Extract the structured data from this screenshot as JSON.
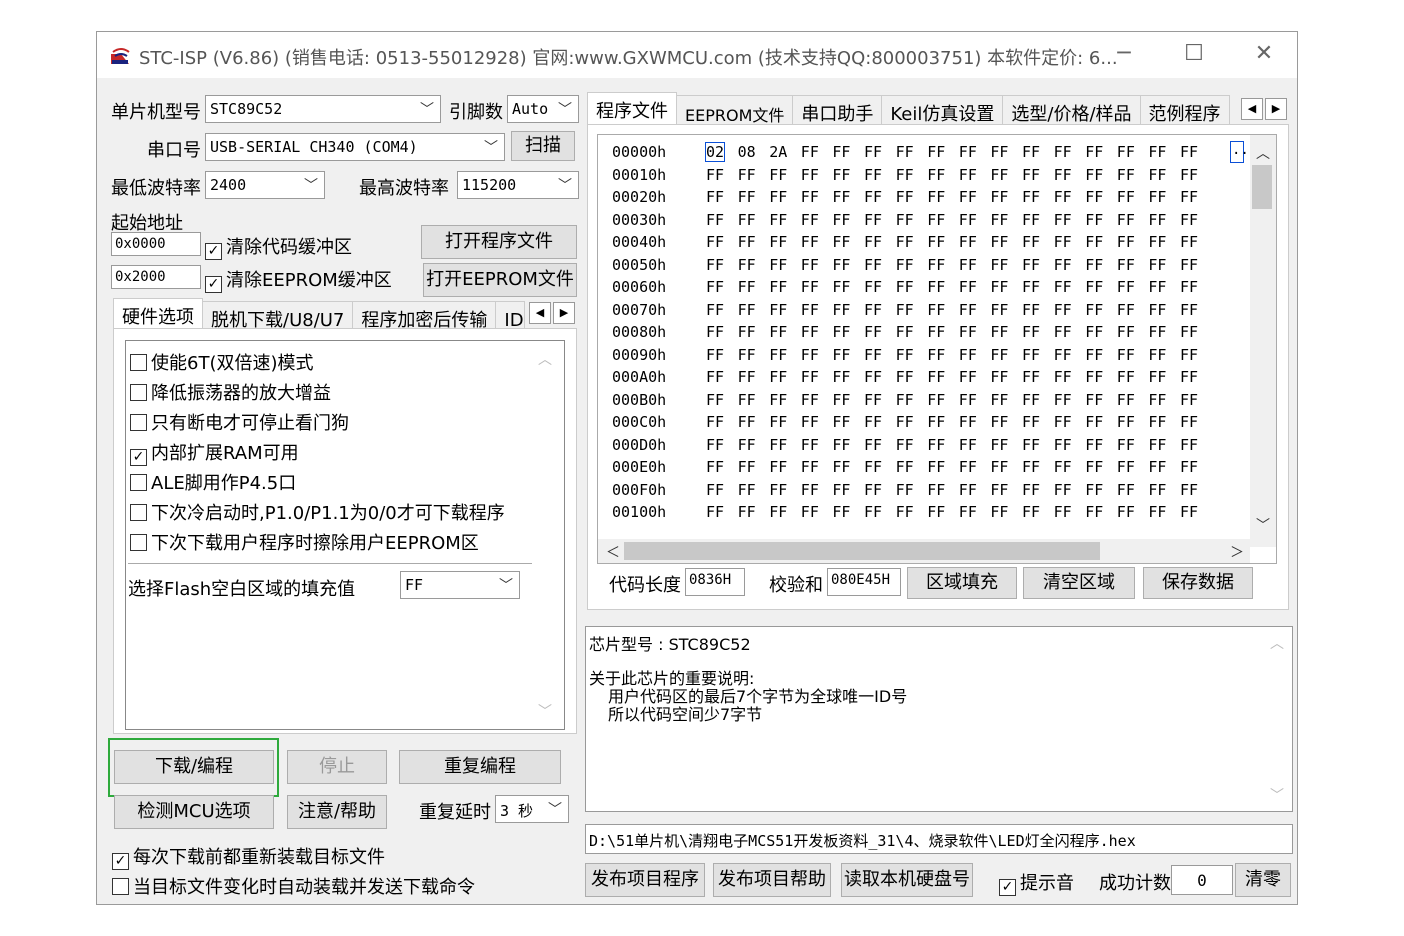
{
  "window": {
    "title": "STC-ISP (V6.86) (销售电话: 0513-55012928) 官网:www.GXWMCU.com  (技术支持QQ:800003751) 本软件定价: 6...",
    "minimize": "─",
    "maximize": "☐",
    "close": "✕"
  },
  "left": {
    "mcu_label": "单片机型号",
    "mcu_value": "STC89C52",
    "pins_label": "引脚数",
    "pins_value": "Auto",
    "port_label": "串口号",
    "port_value": "USB-SERIAL CH340 (COM4)",
    "scan_button": "扫描",
    "min_baud_label": "最低波特率",
    "min_baud_value": "2400",
    "max_baud_label": "最高波特率",
    "max_baud_value": "115200",
    "start_addr_label": "起始地址",
    "addr1": "0x0000",
    "clear_code_label": "清除代码缓冲区",
    "open_program_button": "打开程序文件",
    "addr2": "0x2000",
    "clear_eeprom_label": "清除EEPROM缓冲区",
    "open_eeprom_button": "打开EEPROM文件",
    "tabs": [
      "硬件选项",
      "脱机下载/U8/U7",
      "程序加密后传输",
      "ID号"
    ],
    "options": [
      {
        "label": "使能6T(双倍速)模式",
        "checked": false
      },
      {
        "label": "降低振荡器的放大增益",
        "checked": false
      },
      {
        "label": "只有断电才可停止看门狗",
        "checked": false
      },
      {
        "label": "内部扩展RAM可用",
        "checked": true
      },
      {
        "label": "ALE脚用作P4.5口",
        "checked": false
      },
      {
        "label": "下次冷启动时,P1.0/P1.1为0/0才可下载程序",
        "checked": false
      },
      {
        "label": "下次下载用户程序时擦除用户EEPROM区",
        "checked": false
      }
    ],
    "flash_fill_label": "选择Flash空白区域的填充值",
    "flash_fill_value": "FF",
    "download_button": "下载/编程",
    "stop_button": "停止",
    "reprogram_button": "重复编程",
    "check_mcu_button": "检测MCU选项",
    "help_button": "注意/帮助",
    "repeat_delay_label": "重复延时",
    "repeat_delay_value": "3 秒",
    "reload_label": "每次下载前都重新装载目标文件",
    "auto_load_label": "当目标文件变化时自动装载并发送下载命令"
  },
  "right": {
    "tabs": [
      "程序文件",
      "EEPROM文件",
      "串口助手",
      "Keil仿真设置",
      "选型/价格/样品",
      "范例程序"
    ],
    "hex": {
      "first_row": [
        "02",
        "08",
        "2A",
        "FF",
        "FF",
        "FF",
        "FF",
        "FF",
        "FF",
        "FF",
        "FF",
        "FF",
        "FF",
        "FF",
        "FF",
        "FF"
      ],
      "fill_byte": "FF",
      "addresses": [
        "00000h",
        "00010h",
        "00020h",
        "00030h",
        "00040h",
        "00050h",
        "00060h",
        "00070h",
        "00080h",
        "00090h",
        "000A0h",
        "000B0h",
        "000C0h",
        "000D0h",
        "000E0h",
        "000F0h",
        "00100h"
      ],
      "ascii_first": ".."
    },
    "code_len_label": "代码长度",
    "code_len_value": "0836H",
    "checksum_label": "校验和",
    "checksum_value": "080E45H",
    "fill_region_button": "区域填充",
    "clear_region_button": "清空区域",
    "save_data_button": "保存数据",
    "info": {
      "chip_line": "芯片型号 : STC89C52",
      "note_title": "关于此芯片的重要说明:",
      "note_1": "用户代码区的最后7个字节为全球唯一ID号",
      "note_2": "所以代码空间少7字节"
    },
    "file_path": "D:\\51单片机\\清翔电子MCS51开发板资料_31\\4、烧录软件\\LED灯全闪程序.hex",
    "publish_program_button": "发布项目程序",
    "publish_help_button": "发布项目帮助",
    "read_disk_button": "读取本机硬盘号",
    "beep_label": "提示音",
    "success_count_label": "成功计数",
    "success_count_value": "0",
    "clear_button": "清零"
  },
  "colors": {
    "highlight_green": "#2eaa3c",
    "select_blue": "#0a4fd6"
  }
}
